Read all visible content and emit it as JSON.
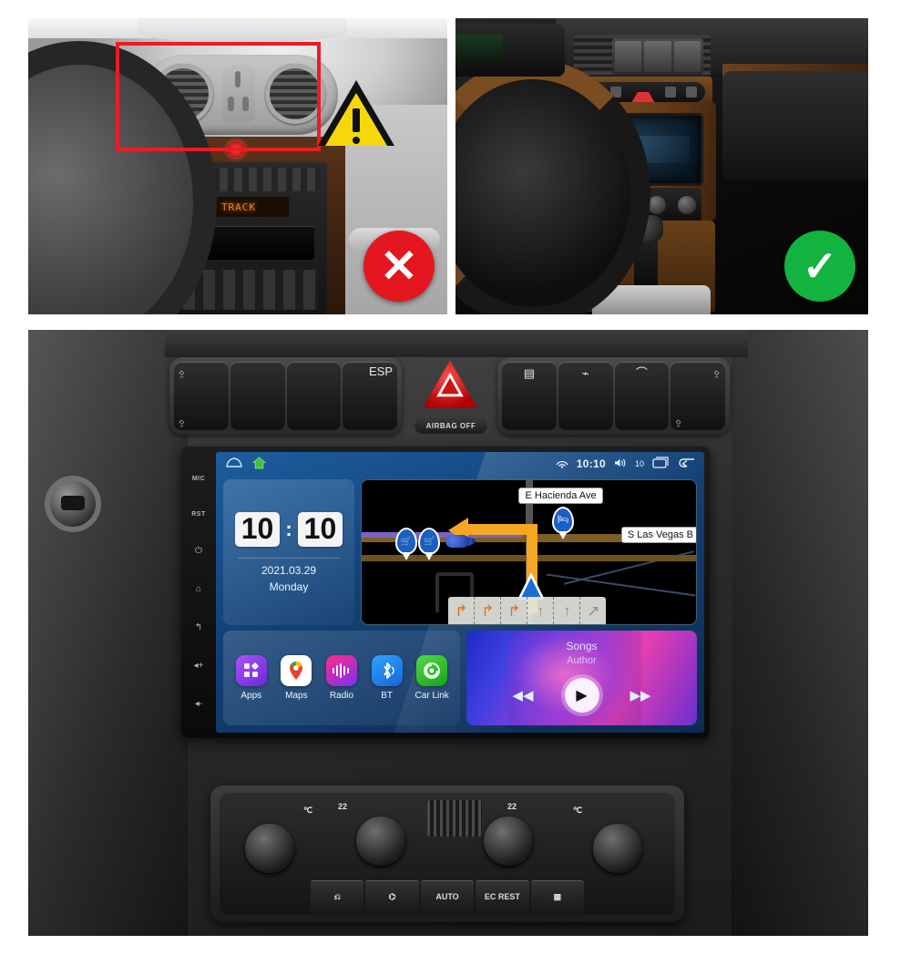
{
  "panels": {
    "wrong": {
      "name": "incorrect-fitment-photo",
      "badge": "✕",
      "warning_icon": "warning-triangle",
      "highlight_box": "red-highlight-box",
      "radio_display_text": "TRACK"
    },
    "correct": {
      "name": "correct-fitment-photo",
      "badge": "✓"
    },
    "main": {
      "name": "installed-head-unit-photo"
    }
  },
  "unit": {
    "side_buttons": [
      {
        "label": "MIC",
        "icon": "mic-label"
      },
      {
        "label": "RST",
        "icon": "reset-label"
      },
      {
        "label": "⏻",
        "icon": "power-icon"
      },
      {
        "label": "⌂",
        "icon": "home-icon"
      },
      {
        "label": "↰",
        "icon": "back-icon"
      },
      {
        "label": "◂+",
        "icon": "volume-up-icon"
      },
      {
        "label": "◂-",
        "icon": "volume-down-icon"
      }
    ],
    "statusbar": {
      "car_icon": "car-outline-icon",
      "home_icon": "home-icon",
      "signal_icon": "wifi-signal-icon",
      "time": "10:10",
      "volume_icon": "volume-icon",
      "volume_level": "10",
      "recents_icon": "recents-icon",
      "back_icon": "back-arrow-icon"
    },
    "clock_widget": {
      "hours": "10",
      "separator": ":",
      "minutes": "10",
      "date": "2021.03.29",
      "weekday": "Monday"
    },
    "map": {
      "street_label_top": "E Hacienda Ave",
      "street_label_right": "S Las Vegas B",
      "poi_icons": [
        "shopping-cart-pin",
        "shopping-cart-pin",
        "poi-cluster",
        "hotel-pin"
      ],
      "lane_guidance": [
        {
          "glyph": "↱",
          "active": true
        },
        {
          "glyph": "↱",
          "active": true
        },
        {
          "glyph": "↱",
          "active": true
        },
        {
          "glyph": "↑",
          "active": false
        },
        {
          "glyph": "↑",
          "active": false
        },
        {
          "glyph": "↗",
          "active": false
        }
      ],
      "vehicle_marker": "navigation-arrow"
    },
    "apps": [
      {
        "label": "Apps",
        "icon": "apps-grid-icon",
        "glyph": "▦"
      },
      {
        "label": "Maps",
        "icon": "maps-pin-icon",
        "glyph": "◉"
      },
      {
        "label": "Radio",
        "icon": "radio-wave-icon",
        "glyph": "⦀"
      },
      {
        "label": "BT",
        "icon": "bluetooth-icon",
        "glyph": "✦"
      },
      {
        "label": "Car Link",
        "icon": "car-link-icon",
        "glyph": "◎"
      }
    ],
    "media": {
      "title": "Songs",
      "author": "Author",
      "prev_icon": "rewind-icon",
      "prev_glyph": "◀◀",
      "play_icon": "play-icon",
      "play_glyph": "▶",
      "next_icon": "fast-forward-icon",
      "next_glyph": "▶▶"
    }
  },
  "dash": {
    "hazard_button": "hazard-triangle-button",
    "airbag_label": "AIRBAG OFF",
    "esp_label": "ESP",
    "left_pod_symbols": [
      "⍚",
      "",
      "",
      "⎙"
    ],
    "right_pod_symbols": [
      "▤",
      "⌁",
      "⌒",
      "⍚"
    ]
  },
  "climate": {
    "temp_left": "22",
    "temp_right": "22",
    "unit_left": "℃",
    "unit_right": "℃",
    "buttons": [
      {
        "label": "⎌",
        "name": "front-defrost-button"
      },
      {
        "label": "⌬",
        "name": "rear-defrost-button"
      },
      {
        "label": "AUTO",
        "name": "auto-button"
      },
      {
        "label": "EC\nREST",
        "name": "ec-rest-button"
      },
      {
        "label": "▦",
        "name": "rear-window-heat-button"
      }
    ]
  },
  "colors": {
    "red_badge": "#e4161f",
    "green_badge": "#12b33f",
    "warning_yellow": "#f5d70a",
    "highlight_red": "#ec1c24",
    "route_orange": "#f5a623",
    "screen_blue": "#1d5d9e"
  }
}
